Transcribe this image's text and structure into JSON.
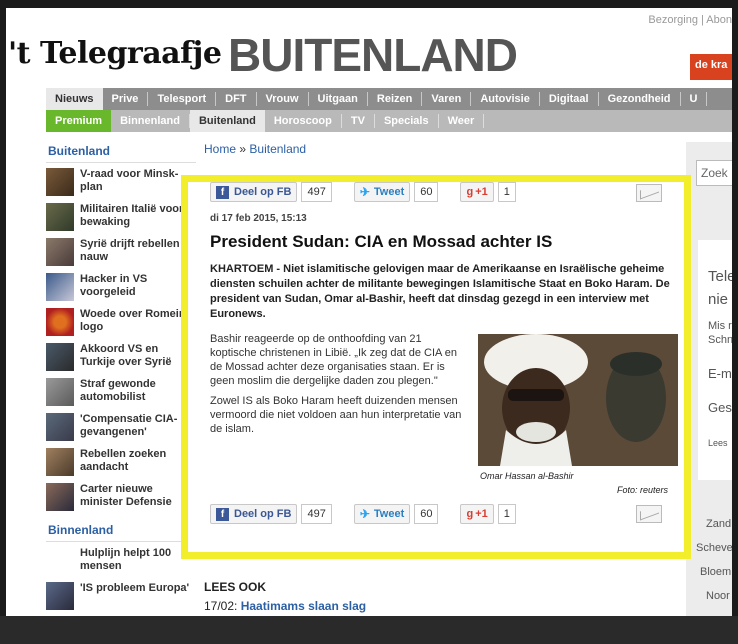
{
  "top_links": "Bezorging | Abon",
  "logo": "'t Telegraafje",
  "section_title": "BUITENLAND",
  "badge": "de kra",
  "nav_primary": [
    "Nieuws",
    "Prive",
    "Telesport",
    "DFT",
    "Vrouw",
    "Uitgaan",
    "Reizen",
    "Varen",
    "Autovisie",
    "Digitaal",
    "Gezondheid",
    "U"
  ],
  "nav_secondary": [
    "Premium",
    "Binnenland",
    "Buitenland",
    "Horoscoop",
    "TV",
    "Specials",
    "Weer"
  ],
  "sidebar": {
    "heading": "Buitenland",
    "items": [
      {
        "label": "V-raad voor Minsk-plan"
      },
      {
        "label": "Militairen Italië voor bewaking"
      },
      {
        "label": "Syrië drijft rebellen in nauw"
      },
      {
        "label": "Hacker in VS voorgeleid"
      },
      {
        "label": "Woede over Romeins logo"
      },
      {
        "label": "Akkoord VS en Turkije over Syrië"
      },
      {
        "label": "Straf gewonde automobilist"
      },
      {
        "label": "'Compensatie CIA-gevangenen'"
      },
      {
        "label": "Rebellen zoeken aandacht"
      },
      {
        "label": "Carter nieuwe minister Defensie"
      }
    ],
    "heading2": "Binnenland",
    "items2": [
      {
        "label": "Hulplijn helpt 100 mensen"
      },
      {
        "label": "'IS probleem Europa'"
      }
    ]
  },
  "breadcrumb": {
    "home": "Home",
    "sep": "»",
    "current": "Buitenland"
  },
  "share": {
    "fb_label": "Deel op FB",
    "fb_count": "497",
    "tweet_label": "Tweet",
    "tweet_count": "60",
    "gplus_label": "+1",
    "gplus_count": "1"
  },
  "article": {
    "date": "di 17 feb 2015, 15:13",
    "headline": "President Sudan: CIA en Mossad achter IS",
    "lead": "KHARTOEM - Niet islamitische gelovigen maar de Amerikaanse en Israëlische geheime diensten schuilen achter de militante bewegingen Islamitische Staat en Boko Haram. De president van Sudan, Omar al-Bashir, heeft dat dinsdag gezegd in een interview met Euronews.",
    "paragraph1": "Bashir reageerde op de onthoofding van 21 koptische christenen in Libië. „Ik zeg dat de CIA en de Mossad achter deze organisaties staan. Er is geen moslim die dergelijke daden zou plegen.\"",
    "paragraph2": "Zowel IS als Boko Haram heeft duizenden mensen vermoord die niet voldoen aan hun interpretatie van de islam.",
    "caption": "Omar Hassan al-Bashir",
    "credit": "Foto: reuters"
  },
  "lees_ook": {
    "heading": "LEES OOK",
    "date": "17/02:",
    "link": "Haatimams slaan slag"
  },
  "right_panel": {
    "search": "Zoek",
    "t1": "Tele",
    "t2": "nie",
    "t3": "Mis r",
    "t4": "Schn",
    "t5": "E-m",
    "t6": "Ges",
    "t7": "Lees",
    "r1": "Zand",
    "r2": "Scheve",
    "r3": "Bloem",
    "r4": "Noor"
  },
  "colors": {
    "highlight": "#f2ee2c",
    "link": "#2c5fa3",
    "premium": "#69b82b",
    "badge": "#d9421f"
  }
}
